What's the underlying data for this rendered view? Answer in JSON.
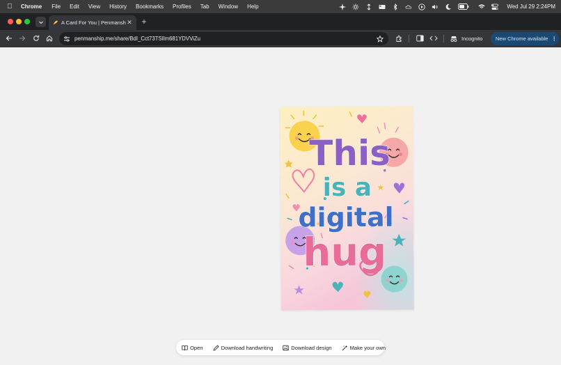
{
  "menubar": {
    "app_name": "Chrome",
    "menus": [
      "File",
      "Edit",
      "View",
      "History",
      "Bookmarks",
      "Profiles",
      "Tab",
      "Window",
      "Help"
    ],
    "clock": "Wed Jul 29  2:24PM"
  },
  "tabs": {
    "active_title": "A Card For You | Penmanship"
  },
  "toolbar": {
    "url": "penmanship.me/share/BdI_Cct73TSIlm681YDVViZu",
    "incognito_label": "Incognito",
    "update_label": "New Chrome available"
  },
  "card": {
    "line1": "This",
    "line2": "is a",
    "line3": "digital",
    "line4": "hug"
  },
  "actions": {
    "open": "Open",
    "download_handwriting": "Download handwriting",
    "download_design": "Download design",
    "make_your_own": "Make your own"
  },
  "colors": {
    "card_top": "#fdf1c4",
    "card_bottom": "#f9d2e0",
    "purple": "#8b5fc4",
    "teal": "#49b3b8",
    "blue": "#3f6fc6",
    "pink": "#e86c98"
  }
}
